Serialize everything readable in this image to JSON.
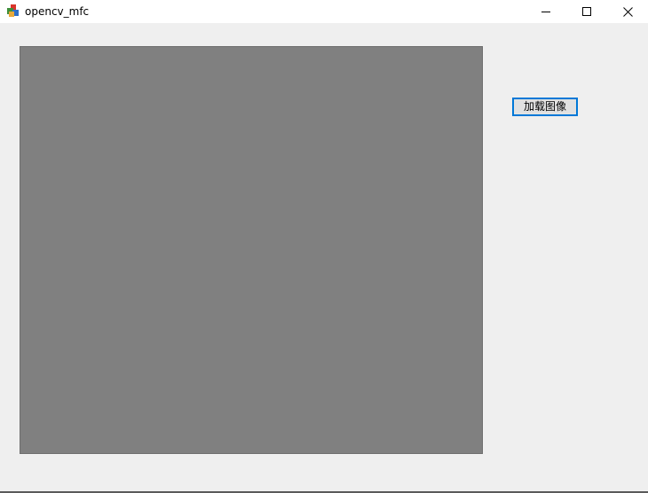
{
  "window": {
    "title": "opencv_mfc",
    "app_icon": "mfc-app-icon",
    "controls": {
      "minimize_icon": "minimize-icon",
      "maximize_icon": "maximize-icon",
      "close_icon": "close-icon"
    }
  },
  "main": {
    "picture_area": {
      "background_color": "#808080"
    },
    "load_button": {
      "label": "加载图像",
      "focus_color": "#0078d7"
    }
  }
}
